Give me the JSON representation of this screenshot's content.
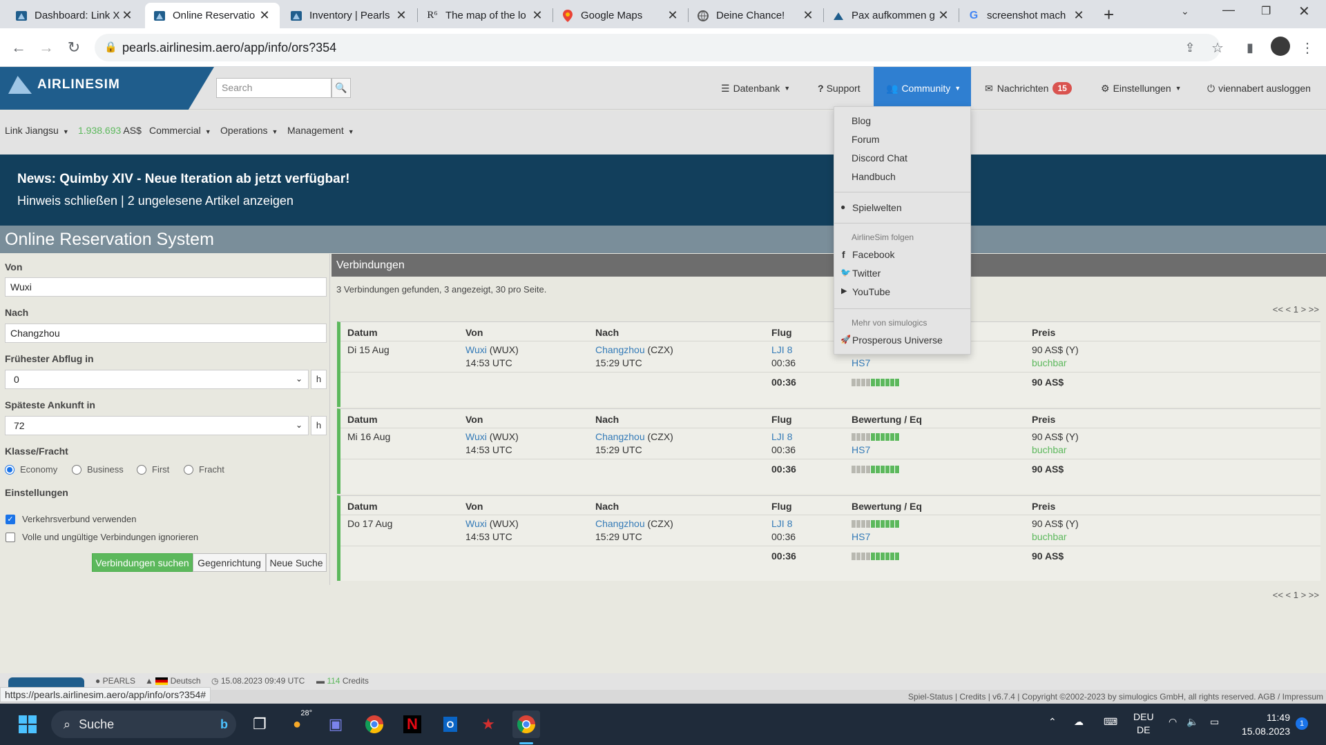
{
  "browser": {
    "tabs": [
      {
        "title": "Dashboard: Link X",
        "icon": "airlinesim-icon"
      },
      {
        "title": "Online Reservatio",
        "icon": "airlinesim-icon"
      },
      {
        "title": "Inventory | Pearls",
        "icon": "airlinesim-icon"
      },
      {
        "title": "The map of the lo",
        "icon": "r6-icon"
      },
      {
        "title": "Google Maps",
        "icon": "maps-pin-icon"
      },
      {
        "title": "Deine Chance!",
        "icon": "globe-icon"
      },
      {
        "title": "Pax aufkommen g",
        "icon": "airlinesim-icon"
      },
      {
        "title": "screenshot mach",
        "icon": "google-icon"
      }
    ],
    "url": "pearls.airlinesim.aero/app/info/ors?354",
    "status_url": "https://pearls.airlinesim.aero/app/info/ors?354#"
  },
  "header": {
    "logo": "AIRLINESIM",
    "search_placeholder": "Search",
    "nav": {
      "datenbank": "Datenbank",
      "support": "Support",
      "community": "Community",
      "nachrichten": "Nachrichten",
      "nachrichten_count": "15",
      "einstellungen": "Einstellungen",
      "logout": "viennabert ausloggen"
    }
  },
  "subnav": {
    "airline": "Link Jiangsu",
    "balance": "1.938.693",
    "currency": "AS$",
    "commercial": "Commercial",
    "operations": "Operations",
    "management": "Management"
  },
  "banner": {
    "title": "News: Quimby XIV - Neue Iteration ab jetzt verfügbar!",
    "links": "Hinweis schließen | 2 ungelesene Artikel anzeigen"
  },
  "page_title": "Online Reservation System",
  "form": {
    "von_label": "Von",
    "von_value": "Wuxi",
    "nach_label": "Nach",
    "nach_value": "Changzhou",
    "earliest_label": "Frühester Abflug in",
    "earliest_value": "0",
    "latest_label": "Späteste Ankunft in",
    "latest_value": "72",
    "unit": "h",
    "class_label": "Klasse/Fracht",
    "classes": [
      "Economy",
      "Business",
      "First",
      "Fracht"
    ],
    "settings_label": "Einstellungen",
    "opt1": "Verkehrsverbund verwenden",
    "opt2": "Volle und ungültige Verbindungen ignorieren",
    "btn_search": "Verbindungen suchen",
    "btn_reverse": "Gegenrichtung",
    "btn_new": "Neue Suche"
  },
  "results": {
    "title": "Verbindungen",
    "info": "3 Verbindungen gefunden, 3 angezeigt, 30 pro Seite.",
    "pager": "<< < 1 > >>",
    "headers": {
      "datum": "Datum",
      "von": "Von",
      "nach": "Nach",
      "flug": "Flug",
      "bewertung": "Bewertung / Eq",
      "preis": "Preis"
    },
    "connections": [
      {
        "datum": "Di 15 Aug",
        "von_city": "Wuxi",
        "von_code": "(WUX)",
        "dep": "14:53 UTC",
        "nach_city": "Changzhou",
        "nach_code": "(CZX)",
        "arr": "15:29 UTC",
        "flight": "LJI 8",
        "duration": "00:36",
        "eq": "HS7",
        "price": "90 AS$ (Y)",
        "status": "buchbar",
        "total_duration": "00:36",
        "total_price": "90 AS$",
        "rating": 0.6,
        "total_rating": 0.6
      },
      {
        "datum": "Mi 16 Aug",
        "von_city": "Wuxi",
        "von_code": "(WUX)",
        "dep": "14:53 UTC",
        "nach_city": "Changzhou",
        "nach_code": "(CZX)",
        "arr": "15:29 UTC",
        "flight": "LJI 8",
        "duration": "00:36",
        "eq": "HS7",
        "price": "90 AS$ (Y)",
        "status": "buchbar",
        "total_duration": "00:36",
        "total_price": "90 AS$",
        "rating": 0.6,
        "total_rating": 0.6
      },
      {
        "datum": "Do 17 Aug",
        "von_city": "Wuxi",
        "von_code": "(WUX)",
        "dep": "14:53 UTC",
        "nach_city": "Changzhou",
        "nach_code": "(CZX)",
        "arr": "15:29 UTC",
        "flight": "LJI 8",
        "duration": "00:36",
        "eq": "HS7",
        "price": "90 AS$ (Y)",
        "status": "buchbar",
        "total_duration": "00:36",
        "total_price": "90 AS$",
        "rating": 0.6,
        "total_rating": 0.6
      }
    ]
  },
  "community_menu": {
    "items1": [
      "Blog",
      "Forum",
      "Discord Chat",
      "Handbuch"
    ],
    "spielwelten": "Spielwelten",
    "follow_head": "AirlineSim folgen",
    "follow": [
      "Facebook",
      "Twitter",
      "YouTube"
    ],
    "more_head": "Mehr von simulogics",
    "more": "Prosperous Universe"
  },
  "footer": {
    "world": "PEARLS",
    "language": "Deutsch",
    "datetime": "15.08.2023 09:49 UTC",
    "credits": "114",
    "credits_label": "Credits",
    "links": "Spiel-Status | Credits | v6.7.4 | Copyright ©2002-2023 by simulogics GmbH, all rights reserved. AGB / Impressum"
  },
  "taskbar": {
    "search": "Suche",
    "weather": "28°",
    "lang1": "DEU",
    "lang2": "DE",
    "time": "11:49",
    "date": "15.08.2023",
    "notif": "1"
  },
  "colors": {
    "accent": "#2f7fd1",
    "banner": "#123f5c",
    "green": "#5cb85c",
    "badge": "#d9534f"
  }
}
